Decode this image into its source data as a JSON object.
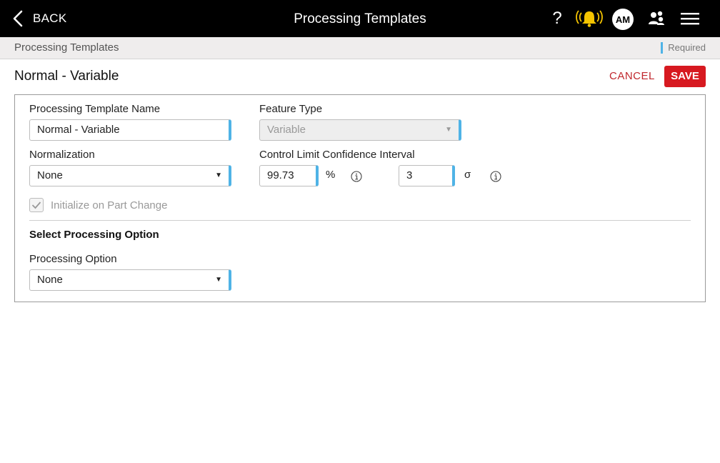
{
  "header": {
    "back_label": "BACK",
    "title": "Processing Templates",
    "help_glyph": "?",
    "avatar_initials": "AM",
    "icons": [
      "chevron-left-icon",
      "help-icon",
      "alarm-bell-icon",
      "users-icon",
      "hamburger-menu-icon"
    ]
  },
  "breadcrumb": {
    "label": "Processing Templates",
    "required_label": "Required"
  },
  "page": {
    "title": "Normal - Variable",
    "cancel_label": "CANCEL",
    "save_label": "SAVE"
  },
  "form": {
    "template_name": {
      "label": "Processing Template Name",
      "value": "Normal - Variable"
    },
    "feature_type": {
      "label": "Feature Type",
      "value": "Variable",
      "disabled": true
    },
    "normalization": {
      "label": "Normalization",
      "value": "None"
    },
    "confidence": {
      "label": "Control Limit Confidence Interval",
      "percent_value": "99.73",
      "percent_unit": "%",
      "sigma_value": "3",
      "sigma_unit": "σ"
    },
    "initialize_on_part_change": {
      "label": "Initialize on Part Change",
      "checked": true,
      "disabled": true
    },
    "section_title": "Select Processing Option",
    "processing_option": {
      "label": "Processing Option",
      "value": "None"
    }
  },
  "colors": {
    "topbar": "#000000",
    "accent_required": "#4fb3e6",
    "save": "#d71920",
    "cancel": "#c0272d",
    "bell": "#f5c400"
  }
}
